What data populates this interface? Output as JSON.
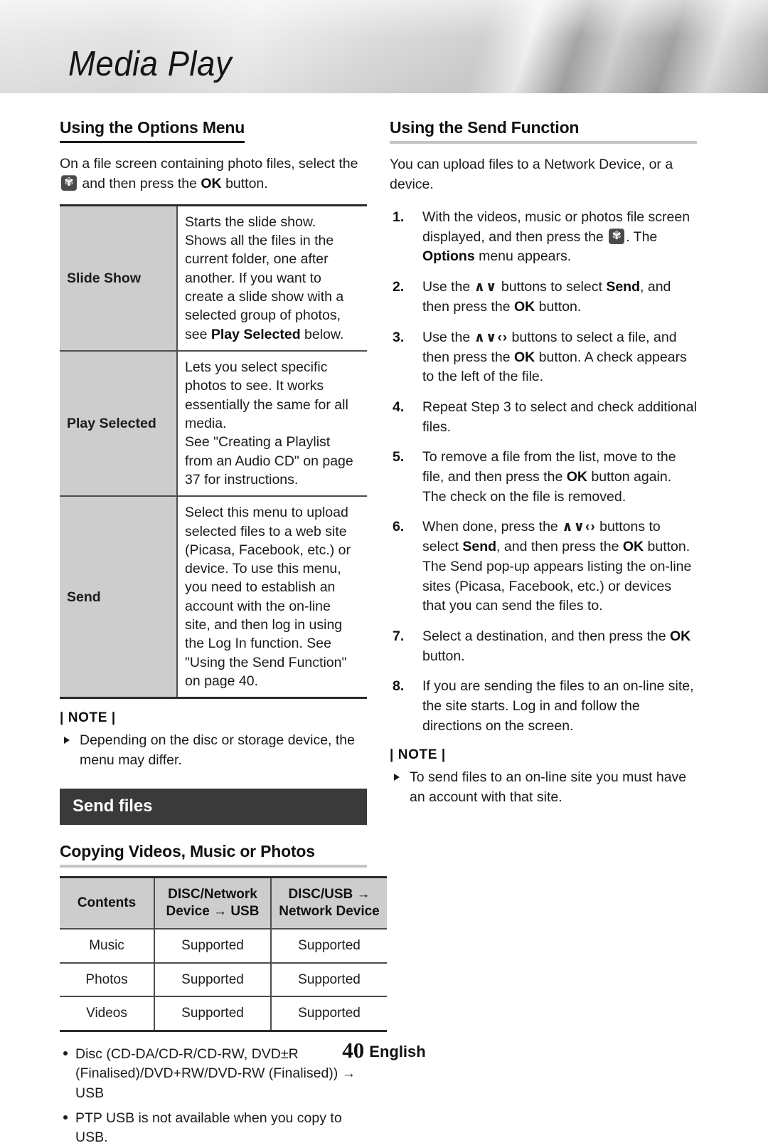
{
  "header": {
    "chapter_title": "Media Play"
  },
  "icons": {
    "gear": "gear-icon",
    "up": "∧",
    "down": "∨",
    "left": "‹",
    "right": "›"
  },
  "left_column": {
    "heading": "Using the Options Menu",
    "intro_before_icon": "On a file screen containing photo files, select the",
    "intro_after_icon": "and then press the",
    "intro_ok": "OK",
    "intro_tail": "button.",
    "options_table": {
      "rows": [
        {
          "name": "Slide Show",
          "desc_before_bold": "Starts the slide show. Shows all the files in the current folder, one after another. If you want to create a slide show with a selected group of photos, see ",
          "desc_bold": "Play Selected",
          "desc_after_bold": " below."
        },
        {
          "name": "Play Selected",
          "desc_before_bold": "Lets you select specific photos to see. It works essentially the same for all media.\nSee \"Creating a Playlist from an Audio CD\" on page 37 for instructions.",
          "desc_bold": "",
          "desc_after_bold": ""
        },
        {
          "name": "Send",
          "desc_before_bold": "Select this menu to upload selected files to a web site (Picasa, Facebook, etc.) or device. To use this menu, you need to establish an account with the on-line site, and then log in using the Log In function. See \"Using the Send Function\" on page 40.",
          "desc_bold": "",
          "desc_after_bold": ""
        }
      ]
    },
    "note": {
      "label": "| NOTE |",
      "items": [
        "Depending on the disc or storage device, the menu may differ."
      ]
    },
    "section_banner": "Send files",
    "subheading": "Copying Videos, Music or Photos",
    "support_table": {
      "headers": [
        "Contents",
        "DISC/Network Device → USB",
        "DISC/USB → Network Device"
      ],
      "header_lines": [
        [
          "Contents"
        ],
        [
          "DISC/Network",
          "Device → USB"
        ],
        [
          "DISC/USB →",
          "Network Device"
        ]
      ],
      "rows": [
        [
          "Music",
          "Supported",
          "Supported"
        ],
        [
          "Photos",
          "Supported",
          "Supported"
        ],
        [
          "Videos",
          "Supported",
          "Supported"
        ]
      ]
    },
    "disc_bullets": [
      "Disc (CD-DA/CD-R/CD-RW, DVD±R (Finalised)/DVD+RW/DVD-RW (Finalised)) → USB",
      "PTP USB is not available when you copy to USB."
    ]
  },
  "right_column": {
    "heading": "Using the Send Function",
    "intro": "You can upload files to a Network Device, or a device.",
    "steps": [
      {
        "id": 1,
        "parts": [
          {
            "t": "text",
            "v": "With the videos, music or photos file screen displayed, and then press the "
          },
          {
            "t": "gear"
          },
          {
            "t": "text",
            "v": ". The "
          },
          {
            "t": "bold",
            "v": "Options"
          },
          {
            "t": "text",
            "v": " menu appears."
          }
        ]
      },
      {
        "id": 2,
        "parts": [
          {
            "t": "text",
            "v": "Use the "
          },
          {
            "t": "chev",
            "v": "∧∨"
          },
          {
            "t": "text",
            "v": " buttons to select "
          },
          {
            "t": "bold",
            "v": "Send"
          },
          {
            "t": "text",
            "v": ", and then press the "
          },
          {
            "t": "bold",
            "v": "OK"
          },
          {
            "t": "text",
            "v": " button."
          }
        ]
      },
      {
        "id": 3,
        "parts": [
          {
            "t": "text",
            "v": "Use the "
          },
          {
            "t": "chev",
            "v": "∧∨‹›"
          },
          {
            "t": "text",
            "v": " buttons to select a file, and then press the "
          },
          {
            "t": "bold",
            "v": "OK"
          },
          {
            "t": "text",
            "v": " button. A check appears to the left of the file."
          }
        ]
      },
      {
        "id": 4,
        "parts": [
          {
            "t": "text",
            "v": "Repeat Step 3 to select and check additional files."
          }
        ]
      },
      {
        "id": 5,
        "parts": [
          {
            "t": "text",
            "v": "To remove a file from the list, move to the file, and then press the "
          },
          {
            "t": "bold",
            "v": "OK"
          },
          {
            "t": "text",
            "v": " button again."
          },
          {
            "t": "br"
          },
          {
            "t": "text",
            "v": "The check on the file is removed."
          }
        ]
      },
      {
        "id": 6,
        "parts": [
          {
            "t": "text",
            "v": "When done, press the "
          },
          {
            "t": "chev",
            "v": "∧∨‹›"
          },
          {
            "t": "text",
            "v": " buttons to select "
          },
          {
            "t": "bold",
            "v": "Send"
          },
          {
            "t": "text",
            "v": ", and then press the "
          },
          {
            "t": "bold",
            "v": "OK"
          },
          {
            "t": "text",
            "v": " button. The Send pop-up appears listing the on-line sites (Picasa, Facebook, etc.) or devices that you can send the files to."
          }
        ]
      },
      {
        "id": 7,
        "parts": [
          {
            "t": "text",
            "v": "Select a destination, and then press the "
          },
          {
            "t": "bold",
            "v": "OK"
          },
          {
            "t": "text",
            "v": " button."
          }
        ]
      },
      {
        "id": 8,
        "parts": [
          {
            "t": "text",
            "v": "If you are sending the files to an on-line site, the site starts. Log in and follow the directions on the screen."
          }
        ]
      }
    ],
    "note": {
      "label": "| NOTE |",
      "items": [
        "To send files to an on-line site you must have an account with that site."
      ]
    }
  },
  "footer": {
    "page_number": "40",
    "language": "English"
  }
}
